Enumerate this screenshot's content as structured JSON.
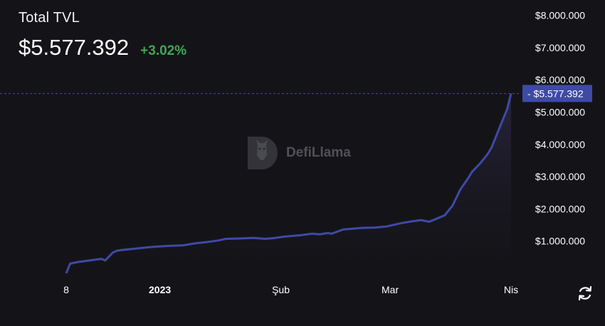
{
  "header": {
    "title": "Total TVL",
    "value": "$5.577.392",
    "change": "+3.02%"
  },
  "colors": {
    "line": "#3f4aa6",
    "area_top": "#2a2540",
    "badge_bg": "#3f4aa6",
    "change_positive": "#3ea856",
    "axis_text": "#ffffff",
    "dashed_line": "#3f4aa6"
  },
  "watermark": {
    "text": "DefiLlama",
    "icon": "defillama-llama-icon"
  },
  "refresh": {
    "icon": "refresh-icon"
  },
  "chart_data": {
    "type": "area",
    "x_tick_labels": [
      "8",
      "2023",
      "Şub",
      "Mar",
      "Nis"
    ],
    "x_tick_days": [
      0,
      24,
      55,
      83,
      114
    ],
    "y_tick_labels": [
      "$1.000.000",
      "$2.000.000",
      "$3.000.000",
      "$4.000.000",
      "$5.000.000",
      "$6.000.000",
      "$7.000.000",
      "$8.000.000"
    ],
    "y_tick_values": [
      1000000,
      2000000,
      3000000,
      4000000,
      5000000,
      6000000,
      7000000,
      8000000
    ],
    "ylim": [
      0,
      8300000
    ],
    "xlim": [
      0,
      116
    ],
    "current_label": "$5.577.392",
    "current_value": 5577392,
    "series": [
      {
        "x": [
          0,
          1,
          3,
          6,
          9,
          10,
          12,
          13,
          14,
          18,
          22,
          26,
          30,
          33,
          36,
          39,
          41,
          44,
          48,
          51,
          53,
          56,
          60,
          63,
          65,
          67,
          68,
          71,
          74,
          76,
          79,
          82,
          86,
          89,
          91,
          93,
          94,
          97,
          99,
          101,
          103,
          104,
          106,
          107,
          108,
          109,
          110,
          111,
          112,
          113,
          114
        ],
        "y": [
          0,
          300000,
          350000,
          400000,
          450000,
          400000,
          650000,
          700000,
          720000,
          770000,
          820000,
          850000,
          870000,
          930000,
          970000,
          1020000,
          1070000,
          1080000,
          1100000,
          1070000,
          1090000,
          1140000,
          1180000,
          1230000,
          1210000,
          1250000,
          1230000,
          1360000,
          1390000,
          1410000,
          1420000,
          1450000,
          1560000,
          1620000,
          1650000,
          1600000,
          1650000,
          1800000,
          2100000,
          2600000,
          2950000,
          3150000,
          3400000,
          3550000,
          3700000,
          3900000,
          4200000,
          4500000,
          4800000,
          5100000,
          5577392
        ]
      }
    ]
  }
}
